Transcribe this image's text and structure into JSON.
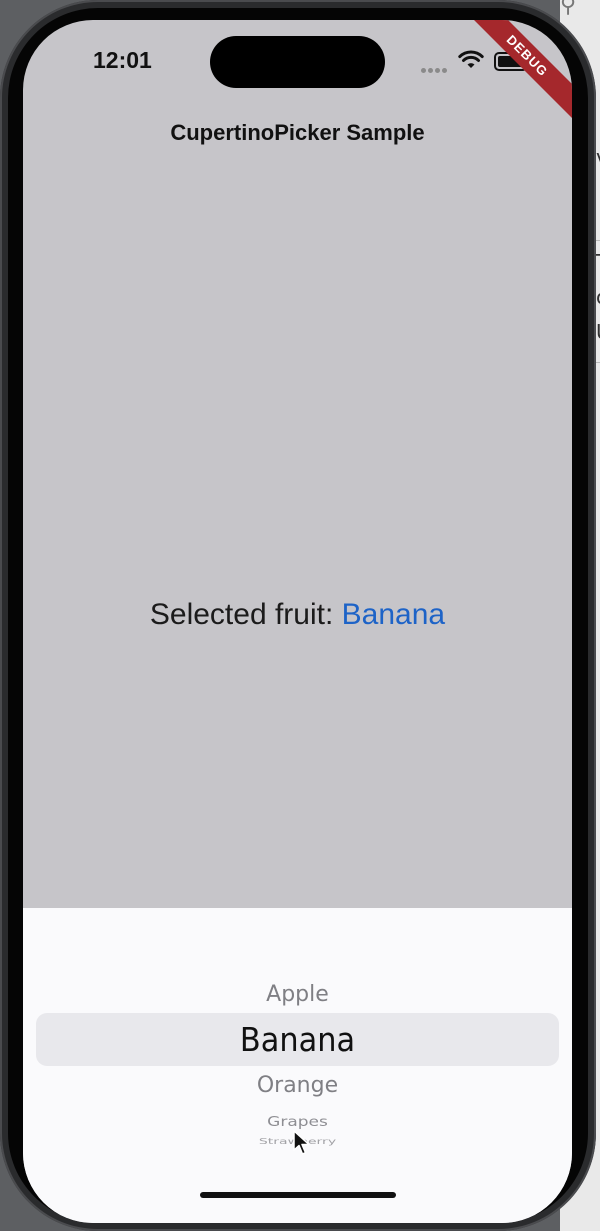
{
  "status_bar": {
    "time": "12:01"
  },
  "debug_banner": "DEBUG",
  "nav": {
    "title": "CupertinoPicker Sample"
  },
  "selection": {
    "label": "Selected fruit: ",
    "value": "Banana"
  },
  "picker": {
    "items": [
      "Apple",
      "Banana",
      "Orange",
      "Grapes",
      "Strawberry"
    ],
    "selected_index": 1
  },
  "background_window": {
    "letters": [
      "v",
      "T",
      "c",
      "U"
    ]
  },
  "colors": {
    "accent": "#1d63c7",
    "screen_bg": "#c6c5c9",
    "sheet_bg": "#fafafc",
    "debug": "#a5282c"
  },
  "icons": [
    "signal-icon",
    "wifi-icon",
    "battery-icon",
    "cursor-icon",
    "search-icon"
  ]
}
